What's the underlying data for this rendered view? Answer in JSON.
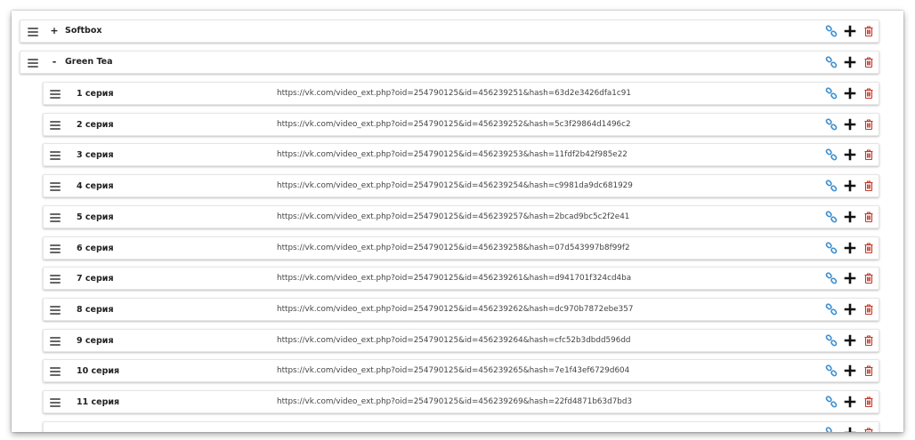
{
  "colors": {
    "link_icon": "#3d8fd0",
    "plus_icon": "#111111",
    "trash_icon": "#c0392b",
    "hamburger_icon": "#666666"
  },
  "playlists": [
    {
      "toggle": "+",
      "title": "Softbox",
      "expanded": false
    },
    {
      "toggle": "-",
      "title": "Green Tea",
      "expanded": true
    }
  ],
  "episodes": [
    {
      "title": "1 серия",
      "url": "https://vk.com/video_ext.php?oid=254790125&id=456239251&hash=63d2e3426dfa1c91"
    },
    {
      "title": "2 серия",
      "url": "https://vk.com/video_ext.php?oid=254790125&id=456239252&hash=5c3f29864d1496c2"
    },
    {
      "title": "3 серия",
      "url": "https://vk.com/video_ext.php?oid=254790125&id=456239253&hash=11fdf2b42f985e22"
    },
    {
      "title": "4 серия",
      "url": "https://vk.com/video_ext.php?oid=254790125&id=456239254&hash=c9981da9dc681929"
    },
    {
      "title": "5 серия",
      "url": "https://vk.com/video_ext.php?oid=254790125&id=456239257&hash=2bcad9bc5c2f2e41"
    },
    {
      "title": "6 серия",
      "url": "https://vk.com/video_ext.php?oid=254790125&id=456239258&hash=07d543997b8f99f2"
    },
    {
      "title": "7 серия",
      "url": "https://vk.com/video_ext.php?oid=254790125&id=456239261&hash=d941701f324cd4ba"
    },
    {
      "title": "8 серия",
      "url": "https://vk.com/video_ext.php?oid=254790125&id=456239262&hash=dc970b7872ebe357"
    },
    {
      "title": "9 серия",
      "url": "https://vk.com/video_ext.php?oid=254790125&id=456239264&hash=cfc52b3dbdd596dd"
    },
    {
      "title": "10 серия",
      "url": "https://vk.com/video_ext.php?oid=254790125&id=456239265&hash=7e1f43ef6729d604"
    },
    {
      "title": "11 серия",
      "url": "https://vk.com/video_ext.php?oid=254790125&id=456239269&hash=22fd4871b63d7bd3"
    }
  ],
  "icons": {
    "drag_handle": "hamburger-icon",
    "copy_link": "link-icon",
    "add": "plus-icon",
    "delete": "trash-icon"
  }
}
